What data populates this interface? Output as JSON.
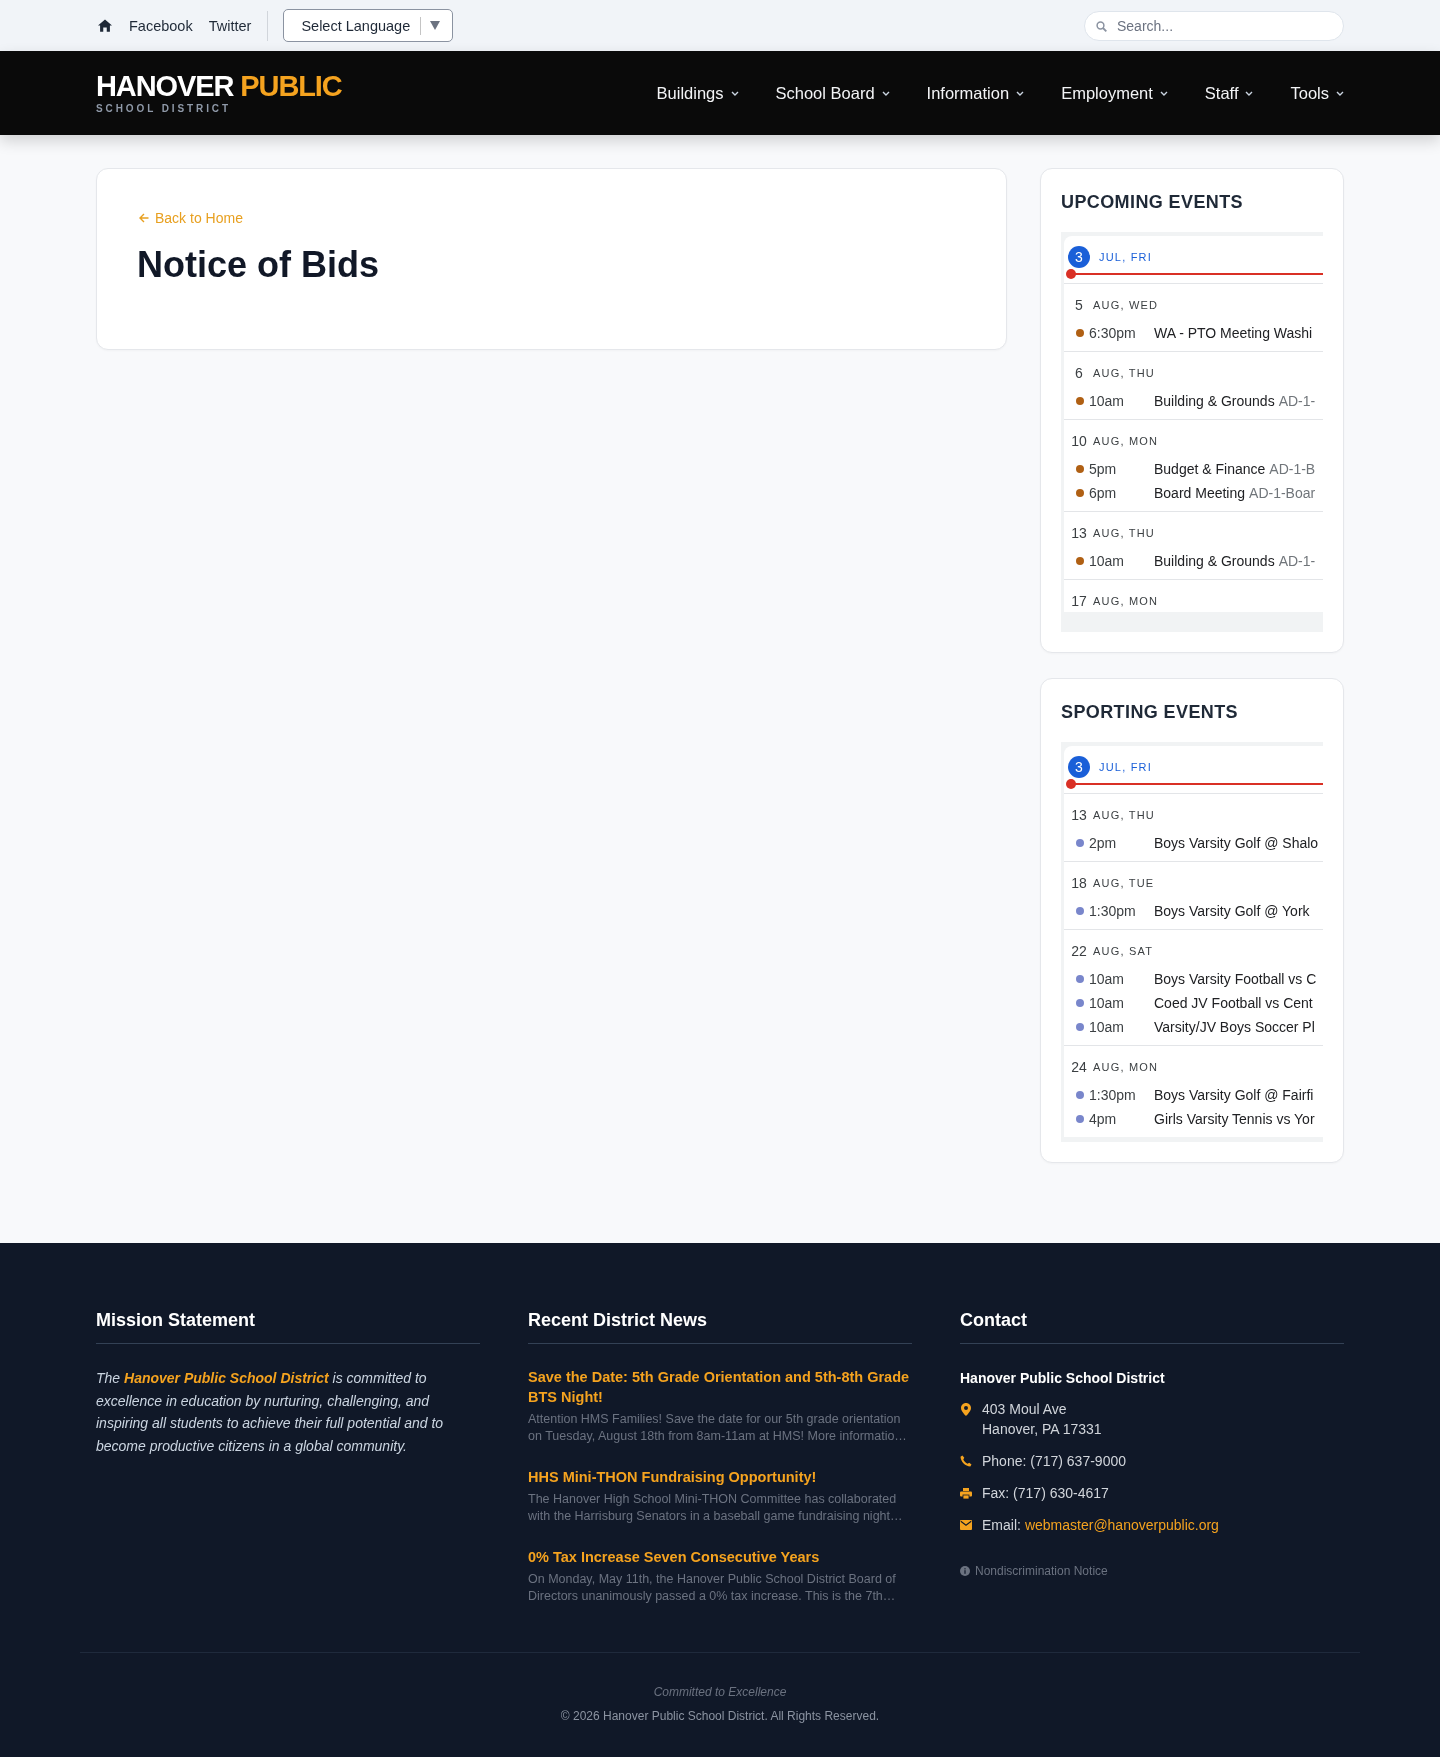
{
  "top_bar": {
    "social_links": [
      "Facebook",
      "Twitter"
    ],
    "language_select": "Select Language",
    "search": {
      "placeholder": "Search..."
    }
  },
  "header": {
    "logo": {
      "name": "HANOVER",
      "accent": "PUBLIC",
      "subtitle": "SCHOOL DISTRICT"
    },
    "nav": [
      "Buildings",
      "School Board",
      "Information",
      "Employment",
      "Staff",
      "Tools"
    ]
  },
  "page": {
    "back_link": "Back to Home",
    "title": "Notice of Bids"
  },
  "sidebar": {
    "calendars": [
      {
        "title": "UPCOMING EVENTS",
        "days": [
          {
            "day": "3",
            "label": "JUL, FRI",
            "today": true
          },
          {
            "day": "5",
            "label": "AUG, WED",
            "today": false,
            "events": [
              {
                "time": "6:30pm",
                "title": "WA - PTO Meeting Washi",
                "color": "#b06014"
              }
            ]
          },
          {
            "day": "6",
            "label": "AUG, THU",
            "today": false,
            "events": [
              {
                "time": "10am",
                "title": "Building & Grounds",
                "location": "AD-1-",
                "color": "#b06014"
              }
            ]
          },
          {
            "day": "10",
            "label": "AUG, MON",
            "today": false,
            "events": [
              {
                "time": "5pm",
                "title": "Budget & Finance",
                "location": "AD-1-B",
                "color": "#b06014"
              },
              {
                "time": "6pm",
                "title": "Board Meeting",
                "location": "AD-1-Boar",
                "color": "#b06014"
              }
            ]
          },
          {
            "day": "13",
            "label": "AUG, THU",
            "today": false,
            "events": [
              {
                "time": "10am",
                "title": "Building & Grounds",
                "location": "AD-1-",
                "color": "#b06014"
              }
            ]
          },
          {
            "day": "17",
            "label": "AUG, MON",
            "today": false
          }
        ]
      },
      {
        "title": "SPORTING EVENTS",
        "days": [
          {
            "day": "3",
            "label": "JUL, FRI",
            "today": true
          },
          {
            "day": "13",
            "label": "AUG, THU",
            "today": false,
            "events": [
              {
                "time": "2pm",
                "title": "Boys Varsity Golf @ Shalo",
                "color": "#7986cb"
              }
            ]
          },
          {
            "day": "18",
            "label": "AUG, TUE",
            "today": false,
            "events": [
              {
                "time": "1:30pm",
                "title": "Boys Varsity Golf @ York",
                "color": "#7986cb"
              }
            ]
          },
          {
            "day": "22",
            "label": "AUG, SAT",
            "today": false,
            "events": [
              {
                "time": "10am",
                "title": "Boys Varsity Football vs C",
                "color": "#7986cb"
              },
              {
                "time": "10am",
                "title": "Coed JV Football vs Cent",
                "color": "#7986cb"
              },
              {
                "time": "10am",
                "title": "Varsity/JV Boys Soccer Pl",
                "color": "#7986cb"
              }
            ]
          },
          {
            "day": "24",
            "label": "AUG, MON",
            "today": false,
            "events": [
              {
                "time": "1:30pm",
                "title": "Boys Varsity Golf @ Fairfi",
                "color": "#7986cb"
              },
              {
                "time": "4pm",
                "title": "Girls Varsity Tennis vs Yor",
                "color": "#7986cb"
              }
            ]
          }
        ]
      }
    ]
  },
  "footer": {
    "mission": {
      "heading": "Mission Statement",
      "text": "The **Hanover Public School District** is committed to excellence in education by nurturing, challenging, and inspiring all students to achieve their full potential and to become productive citizens in a global community."
    },
    "news": {
      "heading": "Recent District News",
      "items": [
        {
          "title": "Save the Date: 5th Grade Orientation and 5th-8th Grade BTS Night!",
          "excerpt": "Attention HMS Families! Save the date for our 5th grade orientation on Tuesday, August 18th from 8am-11am at HMS! More informatio…"
        },
        {
          "title": "HHS Mini-THON Fundraising Opportunity!",
          "excerpt": "The Hanover High School Mini-THON Committee has collaborated with the Harrisburg Senators in a baseball game fundraising night…"
        },
        {
          "title": "0% Tax Increase Seven Consecutive Years",
          "excerpt": "On Monday, May 11th, the Hanover Public School District Board of Directors unanimously passed a 0% tax increase. This is the 7th…"
        }
      ]
    },
    "contact": {
      "heading": "Contact",
      "organization": "Hanover Public School District",
      "address": [
        "403 Moul Ave",
        "Hanover, PA 17331"
      ],
      "phone": "Phone: (717) 637-9000",
      "fax": "Fax: (717) 630-4617",
      "email_label": "Email:",
      "email": "webmaster@hanoverpublic.org",
      "notice_link": "Nondiscrimination Notice"
    },
    "tagline": "Committed to Excellence",
    "copyright": "© 2026 Hanover Public School District. All Rights Reserved."
  }
}
